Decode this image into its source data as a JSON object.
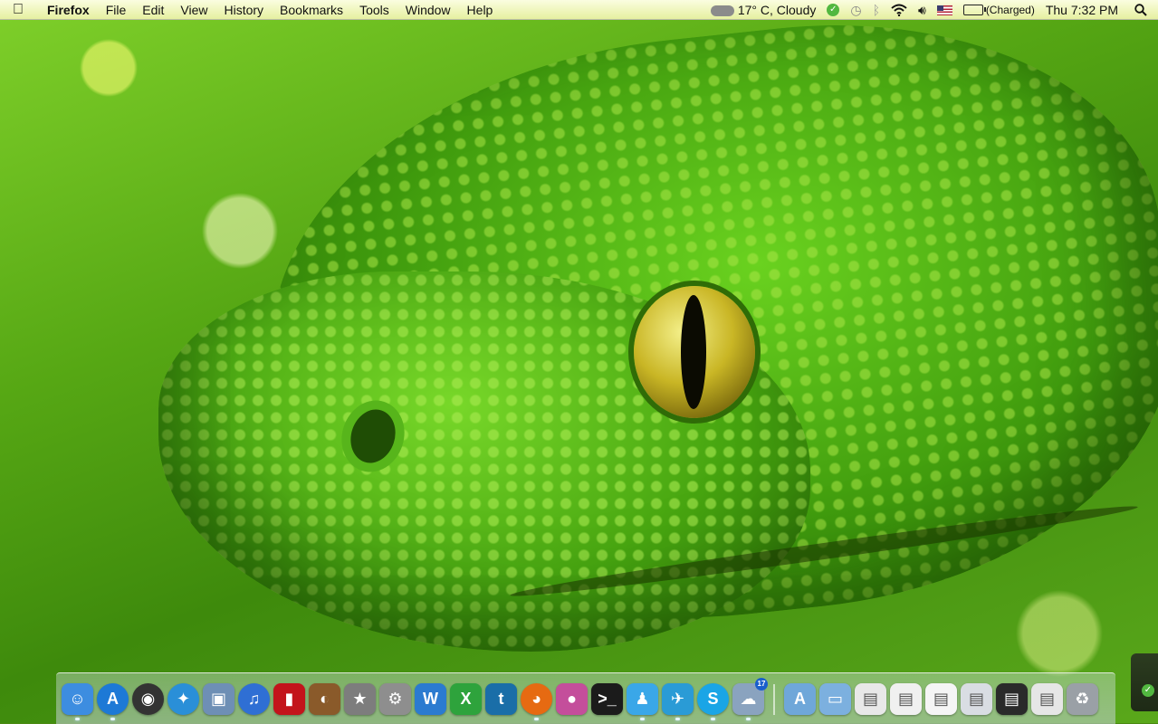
{
  "menubar": {
    "app_name": "Firefox",
    "menus": [
      "File",
      "Edit",
      "View",
      "History",
      "Bookmarks",
      "Tools",
      "Window",
      "Help"
    ],
    "weather": "17° C, Cloudy",
    "battery_status": "(Charged)",
    "clock": "Thu 7:32 PM",
    "icons": [
      "apple-icon",
      "cloud-icon",
      "evernote-check-icon",
      "time-machine-icon",
      "bluetooth-icon",
      "wifi-icon",
      "volume-icon",
      "us-flag-icon",
      "battery-icon",
      "spotlight-search-icon"
    ]
  },
  "dock": {
    "apps": [
      {
        "name": "finder",
        "glyph": "☺",
        "color": "#3d8de0"
      },
      {
        "name": "app-store",
        "glyph": "A",
        "color": "#1d79d6"
      },
      {
        "name": "dashboard",
        "glyph": "◉",
        "color": "#333333"
      },
      {
        "name": "safari",
        "glyph": "✦",
        "color": "#2a8fd8"
      },
      {
        "name": "preview",
        "glyph": "▣",
        "color": "#6e8fb5"
      },
      {
        "name": "itunes",
        "glyph": "♫",
        "color": "#2f6fd4"
      },
      {
        "name": "photo-booth",
        "glyph": "▮",
        "color": "#c3141b"
      },
      {
        "name": "iphoto",
        "glyph": "◐",
        "color": "#8a5a2a"
      },
      {
        "name": "imovie",
        "glyph": "★",
        "color": "#7d7d7d"
      },
      {
        "name": "system-preferences",
        "glyph": "⚙",
        "color": "#8e8e8e"
      },
      {
        "name": "word",
        "glyph": "W",
        "color": "#2b7bd0"
      },
      {
        "name": "excel",
        "glyph": "X",
        "color": "#2ea33c"
      },
      {
        "name": "tweetdeck",
        "glyph": "t",
        "color": "#1a6ea8"
      },
      {
        "name": "firefox",
        "glyph": "◕",
        "color": "#e66a12"
      },
      {
        "name": "colorsync",
        "glyph": "●",
        "color": "#c44e9b"
      },
      {
        "name": "terminal",
        "glyph": ">_",
        "color": "#1b1b1b"
      },
      {
        "name": "messenger",
        "glyph": "♟",
        "color": "#3aa7e8"
      },
      {
        "name": "twitter",
        "glyph": "✈",
        "color": "#2a9bd6"
      },
      {
        "name": "skype",
        "glyph": "S",
        "color": "#1aa5e6"
      },
      {
        "name": "weather",
        "glyph": "☁",
        "color": "#8aa3bf",
        "badge": "17"
      }
    ],
    "docs": [
      {
        "name": "applications-folder",
        "glyph": "A",
        "color": "#6fa7d9"
      },
      {
        "name": "documents-folder",
        "glyph": "▭",
        "color": "#7cb0df"
      },
      {
        "name": "stack-1",
        "glyph": "▤",
        "color": "#e8e8e8"
      },
      {
        "name": "stack-2",
        "glyph": "▤",
        "color": "#f0f0f0"
      },
      {
        "name": "stack-3",
        "glyph": "▤",
        "color": "#f5f5f5"
      },
      {
        "name": "stack-4",
        "glyph": "▤",
        "color": "#d9dde3"
      },
      {
        "name": "stack-5",
        "glyph": "▤",
        "color": "#2a2a2a"
      },
      {
        "name": "stack-6",
        "glyph": "▤",
        "color": "#e6e6e6"
      },
      {
        "name": "trash",
        "glyph": "♻",
        "color": "#9aa0a6"
      }
    ]
  }
}
